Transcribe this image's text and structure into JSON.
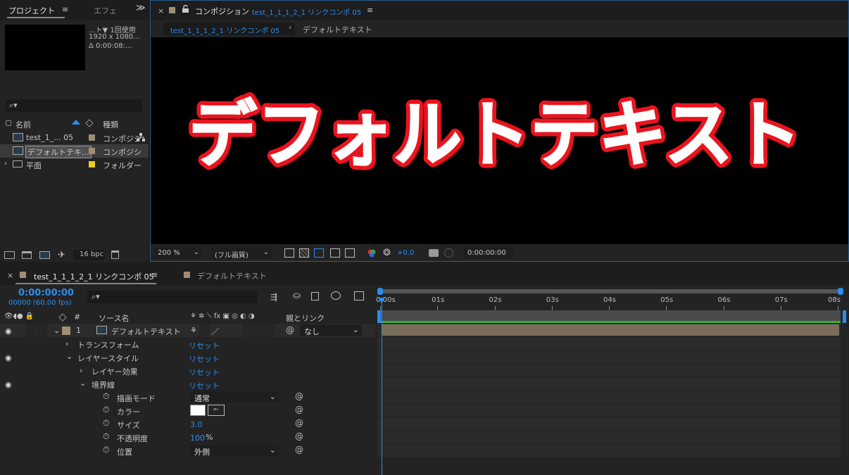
{
  "project": {
    "tab_label": "プロジェクト",
    "menu_glyph": "≡",
    "tab2_label": "エフェ",
    "more_glyph": "≫",
    "info_line1": "...ト▼ 1回使用",
    "info_line2": "1920 x 1080...",
    "info_line3": "Δ 0:00:08:...",
    "search_glyph": "⌕▾",
    "col_name": "名前",
    "col_type": "種類",
    "items": [
      {
        "name": "test_1_... 05",
        "type": "コンポジシ",
        "swatch": "#a08e74"
      },
      {
        "name": "デフォルトテキ...",
        "type": "コンポジシ",
        "swatch": "#a08e74"
      },
      {
        "name": "平面",
        "type": "フォルダー",
        "swatch": "#e8c830"
      }
    ],
    "bpc_label": "16 bpc"
  },
  "comp": {
    "close_glyph": "×",
    "lock_glyph": "🔓",
    "title_prefix": "コンポジション",
    "comp_name": "test_1_1_1_2_1 リンクコンポ 05",
    "menu_glyph": "≡",
    "breadcrumb": [
      "test_1_1_1_2_1 リンクコンポ 05",
      "デフォルトテキスト"
    ],
    "chevron_glyph": "‹",
    "viewer_text": "デフォルトテキスト",
    "zoom": "200 %",
    "resolution": "(フル画質)",
    "exposure": "+0.0",
    "timecode": "0:00:00:00"
  },
  "timeline": {
    "close_glyph": "×",
    "tab1": "test_1_1_1_2_1 リンクコンポ 05",
    "menu_glyph": "≡",
    "tab2": "デフォルトテキスト",
    "timecode": "0:00:00:00",
    "frames": "00000 (60.00 fps)",
    "col_hash": "#",
    "col_source": "ソース名",
    "col_switches": "⚘ ✲ ⟍ fx ▣ ◎ ◐ ◑",
    "col_parent": "親とリンク",
    "layer": {
      "index": "1",
      "name": "デフォルトテキスト",
      "parent": "なし"
    },
    "props": [
      {
        "label": "トランスフォーム",
        "value": "リセット"
      },
      {
        "label": "レイヤースタイル",
        "value": "リセット"
      },
      {
        "label": "レイヤー効果",
        "value": "リセット"
      },
      {
        "label": "境界線",
        "value": "リセット"
      }
    ],
    "stroke": {
      "blend_label": "描画モード",
      "blend_value": "通常",
      "color_label": "カラー",
      "size_label": "サイズ",
      "size_value": "3.0",
      "opacity_label": "不透明度",
      "opacity_value": "100",
      "opacity_unit": "%",
      "position_label": "位置",
      "position_value": "外側"
    },
    "ruler": [
      "0:00s",
      "01s",
      "02s",
      "03s",
      "04s",
      "05s",
      "06s",
      "07s",
      "08s"
    ]
  },
  "colors": {
    "accent": "#2d8ceb",
    "text_red": "#e8141e",
    "work_area_green": "#31b337",
    "layer_bar": "#7a6c5a"
  }
}
